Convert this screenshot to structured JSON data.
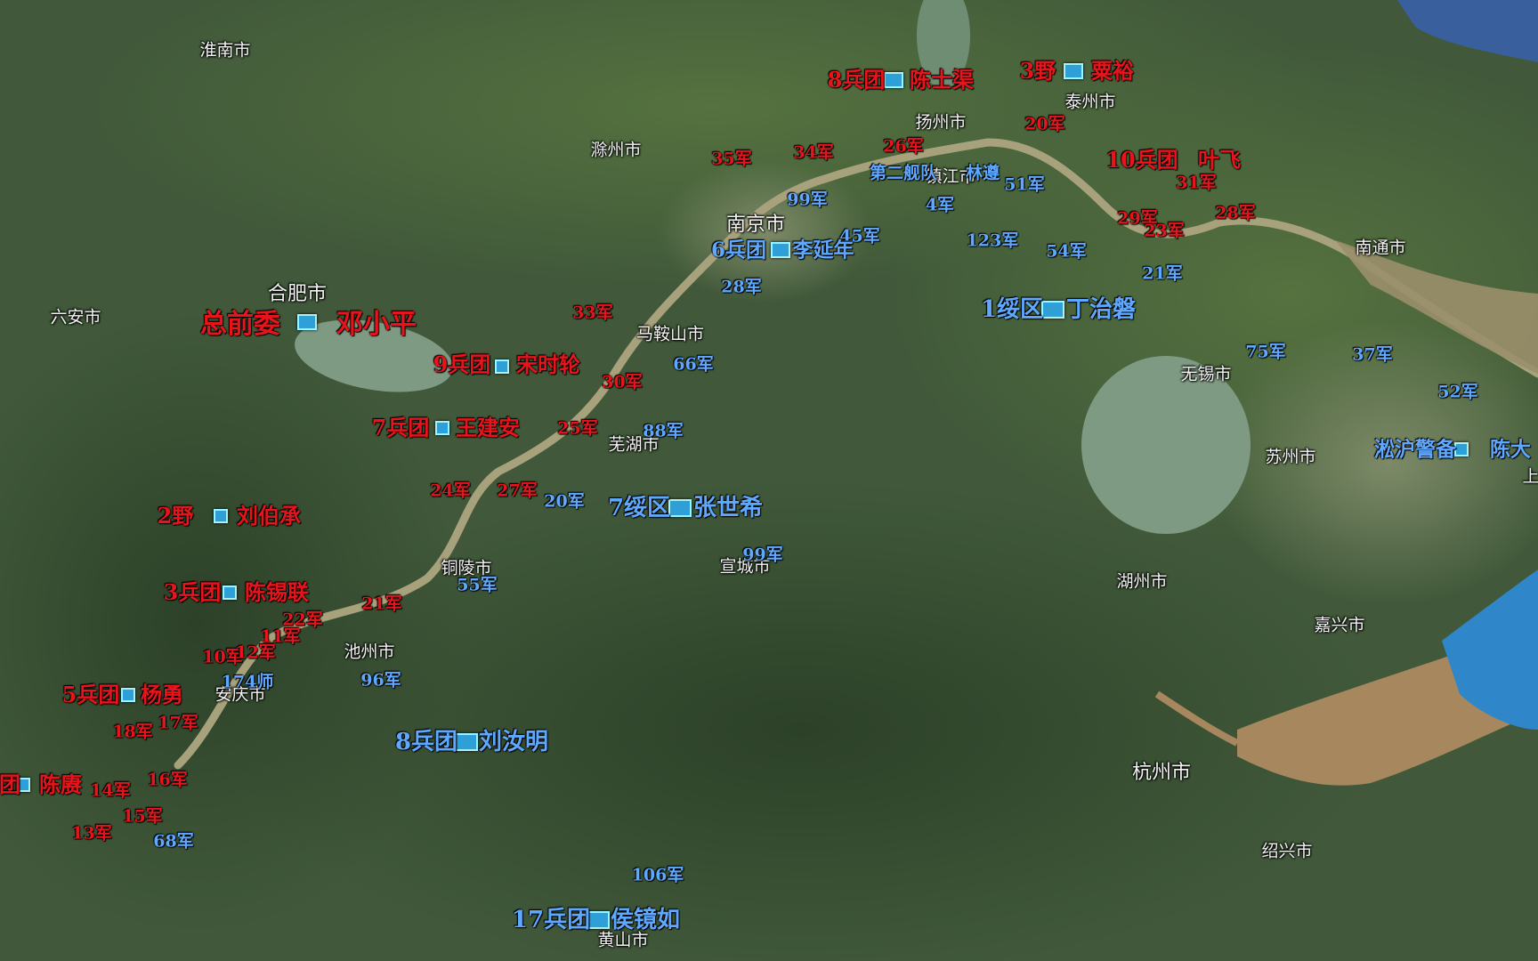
{
  "map": {
    "colors": {
      "land": "#3f5a35",
      "water": "#7e9a82",
      "river": "#a7a17c",
      "sea": "#2f86c9",
      "silt": "#a7875e",
      "red_label": "#e8141c",
      "blue_label": "#5ea9ff",
      "city_label": "#f4f4f4"
    },
    "cities": [
      {
        "name": "淮南市"
      },
      {
        "name": "滁州市"
      },
      {
        "name": "扬州市"
      },
      {
        "name": "泰州市"
      },
      {
        "name": "镇江市"
      },
      {
        "name": "南京市"
      },
      {
        "name": "南通市"
      },
      {
        "name": "合肥市"
      },
      {
        "name": "六安市"
      },
      {
        "name": "马鞍山市"
      },
      {
        "name": "无锡市"
      },
      {
        "name": "芜湖市"
      },
      {
        "name": "苏州市"
      },
      {
        "name": "上"
      },
      {
        "name": "铜陵市"
      },
      {
        "name": "宣城市"
      },
      {
        "name": "湖州市"
      },
      {
        "name": "嘉兴市"
      },
      {
        "name": "池州市"
      },
      {
        "name": "安庆市"
      },
      {
        "name": "杭州市"
      },
      {
        "name": "绍兴市"
      },
      {
        "name": "黄山市"
      }
    ],
    "red_units": [
      {
        "text": "8兵团"
      },
      {
        "text": "陈士渠"
      },
      {
        "text": "3野"
      },
      {
        "text": "粟裕"
      },
      {
        "text": "20军"
      },
      {
        "text": "35军"
      },
      {
        "text": "34军"
      },
      {
        "text": "26军"
      },
      {
        "text": "10兵团"
      },
      {
        "text": "叶飞"
      },
      {
        "text": "31军"
      },
      {
        "text": "29军"
      },
      {
        "text": "23军"
      },
      {
        "text": "28军"
      },
      {
        "text": "总前委"
      },
      {
        "text": "邓小平"
      },
      {
        "text": "33军"
      },
      {
        "text": "9兵团"
      },
      {
        "text": "宋时轮"
      },
      {
        "text": "30军"
      },
      {
        "text": "7兵团"
      },
      {
        "text": "王建安"
      },
      {
        "text": "25军"
      },
      {
        "text": "24军"
      },
      {
        "text": "27军"
      },
      {
        "text": "2野"
      },
      {
        "text": "刘伯承"
      },
      {
        "text": "3兵团"
      },
      {
        "text": "陈锡联"
      },
      {
        "text": "21军"
      },
      {
        "text": "22军"
      },
      {
        "text": "11军"
      },
      {
        "text": "10军"
      },
      {
        "text": "12军"
      },
      {
        "text": "5兵团"
      },
      {
        "text": "杨勇"
      },
      {
        "text": "18军"
      },
      {
        "text": "17军"
      },
      {
        "text": "团"
      },
      {
        "text": "陈赓"
      },
      {
        "text": "14军"
      },
      {
        "text": "16军"
      },
      {
        "text": "15军"
      },
      {
        "text": "13军"
      }
    ],
    "blue_units": [
      {
        "text": "第二舰队"
      },
      {
        "text": "林遵"
      },
      {
        "text": "51军"
      },
      {
        "text": "99军"
      },
      {
        "text": "4军"
      },
      {
        "text": "45军"
      },
      {
        "text": "6兵团"
      },
      {
        "text": "李延年"
      },
      {
        "text": "123军"
      },
      {
        "text": "54军"
      },
      {
        "text": "21军"
      },
      {
        "text": "28军"
      },
      {
        "text": "1绥区"
      },
      {
        "text": "丁治磐"
      },
      {
        "text": "66军"
      },
      {
        "text": "75军"
      },
      {
        "text": "37军"
      },
      {
        "text": "52军"
      },
      {
        "text": "88军"
      },
      {
        "text": "淞沪警备"
      },
      {
        "text": "陈大"
      },
      {
        "text": "20军"
      },
      {
        "text": "7绥区"
      },
      {
        "text": "张世希"
      },
      {
        "text": "99军"
      },
      {
        "text": "55军"
      },
      {
        "text": "174师"
      },
      {
        "text": "96军"
      },
      {
        "text": "8兵团"
      },
      {
        "text": "刘汝明"
      },
      {
        "text": "68军"
      },
      {
        "text": "106军"
      },
      {
        "text": "17兵团"
      },
      {
        "text": "侯镜如"
      }
    ]
  }
}
